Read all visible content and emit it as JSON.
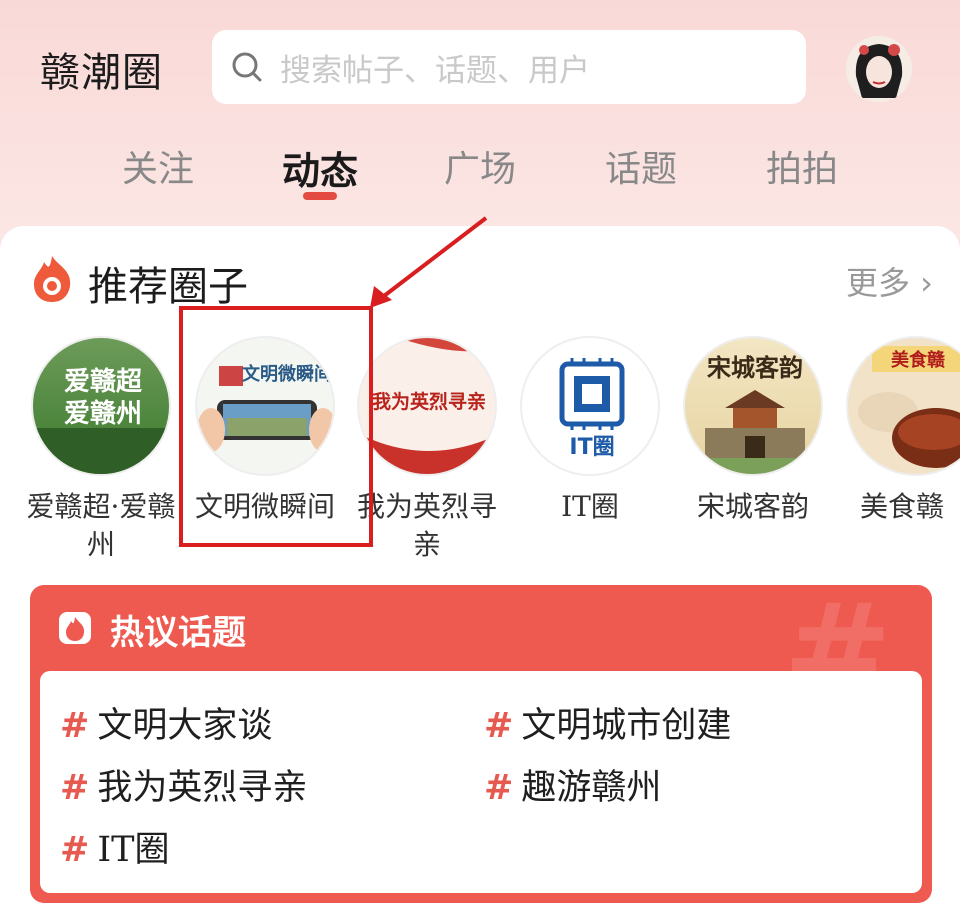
{
  "header": {
    "app_title": "赣潮圈",
    "search_placeholder": "搜索帖子、话题、用户"
  },
  "tabs": [
    {
      "label": "关注",
      "active": false
    },
    {
      "label": "动态",
      "active": true
    },
    {
      "label": "广场",
      "active": false
    },
    {
      "label": "话题",
      "active": false
    },
    {
      "label": "拍拍",
      "active": false
    }
  ],
  "recommended": {
    "title": "推荐圈子",
    "more_label": "更多 ›",
    "circles": [
      {
        "name": "爱赣超·爱赣州",
        "image_text": "爱赣超爱赣州"
      },
      {
        "name": "文明微瞬间",
        "image_text": "文明微瞬间"
      },
      {
        "name": "我为英烈寻亲",
        "image_text": "我为英烈寻亲"
      },
      {
        "name": "IT圈",
        "image_text": "IT圈"
      },
      {
        "name": "宋城客韵",
        "image_text": "宋城客韵"
      },
      {
        "name": "美食赣",
        "image_text": "美食赣"
      }
    ]
  },
  "hot_topics": {
    "title": "热议话题",
    "items": [
      "文明大家谈",
      "文明城市创建",
      "我为英烈寻亲",
      "趣游赣州",
      "IT圈"
    ]
  },
  "colors": {
    "accent": "#e34a40",
    "hot_bg": "#ee5a50",
    "annotation": "#d81e1e"
  }
}
